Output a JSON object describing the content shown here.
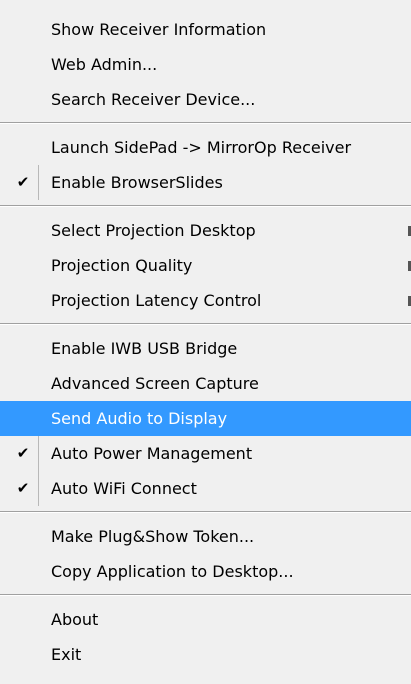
{
  "menu": {
    "group1": [
      {
        "label": "Show Receiver Information"
      },
      {
        "label": "Web Admin..."
      },
      {
        "label": "Search Receiver Device..."
      }
    ],
    "group2": [
      {
        "label": "Launch SidePad -> MirrorOp Receiver"
      },
      {
        "label": "Enable BrowserSlides",
        "checked": true
      }
    ],
    "group3": [
      {
        "label": "Select Projection Desktop",
        "submenu": true
      },
      {
        "label": "Projection Quality",
        "submenu": true
      },
      {
        "label": "Projection Latency Control",
        "submenu": true
      }
    ],
    "group4": [
      {
        "label": "Enable IWB USB Bridge"
      },
      {
        "label": "Advanced Screen Capture"
      },
      {
        "label": "Send Audio to Display",
        "highlighted": true
      },
      {
        "label": "Auto Power Management",
        "checked": true
      },
      {
        "label": "Auto WiFi Connect",
        "checked": true
      }
    ],
    "group5": [
      {
        "label": "Make Plug&Show Token..."
      },
      {
        "label": "Copy Application to Desktop..."
      }
    ],
    "group6": [
      {
        "label": "About"
      },
      {
        "label": "Exit"
      }
    ],
    "check_glyph": "✔",
    "highlight_color": "#3399ff"
  }
}
